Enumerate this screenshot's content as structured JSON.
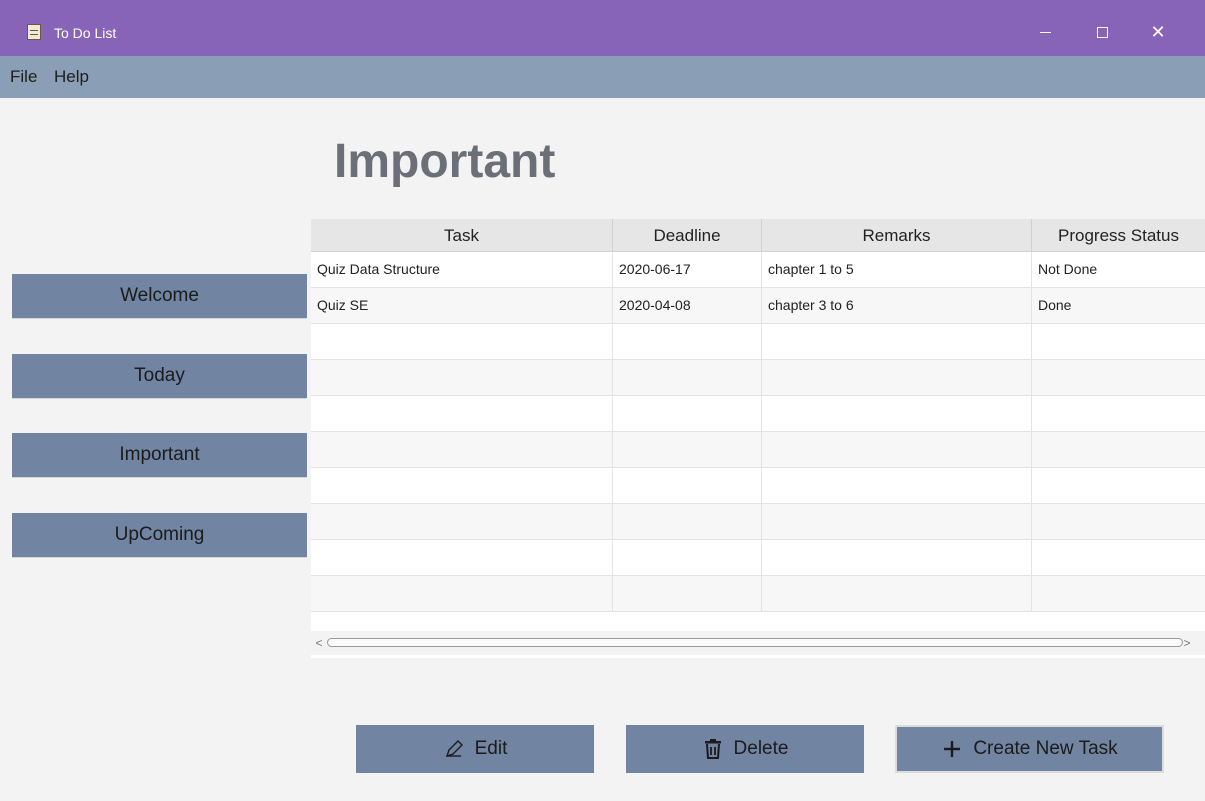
{
  "window": {
    "title": "To Do List",
    "minimize_icon": "minimize-icon",
    "maximize_icon": "maximize-icon",
    "close_glyph": "✕"
  },
  "menu": {
    "items": [
      {
        "label": "File"
      },
      {
        "label": "Help"
      }
    ]
  },
  "main": {
    "title": "Important"
  },
  "sidebar": {
    "items": [
      {
        "label": "Welcome"
      },
      {
        "label": "Today"
      },
      {
        "label": "Important"
      },
      {
        "label": "UpComing"
      }
    ]
  },
  "table": {
    "columns": [
      "Task",
      "Deadline",
      "Remarks",
      "Progress Status"
    ],
    "rows": [
      [
        "Quiz Data Structure",
        "2020-06-17",
        "chapter 1 to 5",
        "Not Done"
      ],
      [
        "Quiz SE",
        "2020-04-08",
        "chapter 3 to 6",
        "Done"
      ]
    ],
    "scroll_left": "<",
    "scroll_right": ">"
  },
  "actions": {
    "edit_label": "Edit",
    "delete_label": "Delete",
    "create_label": "Create New Task"
  },
  "colors": {
    "titlebar": "#8764b8",
    "menubar": "#8a9fb5",
    "button": "#7184a2"
  }
}
